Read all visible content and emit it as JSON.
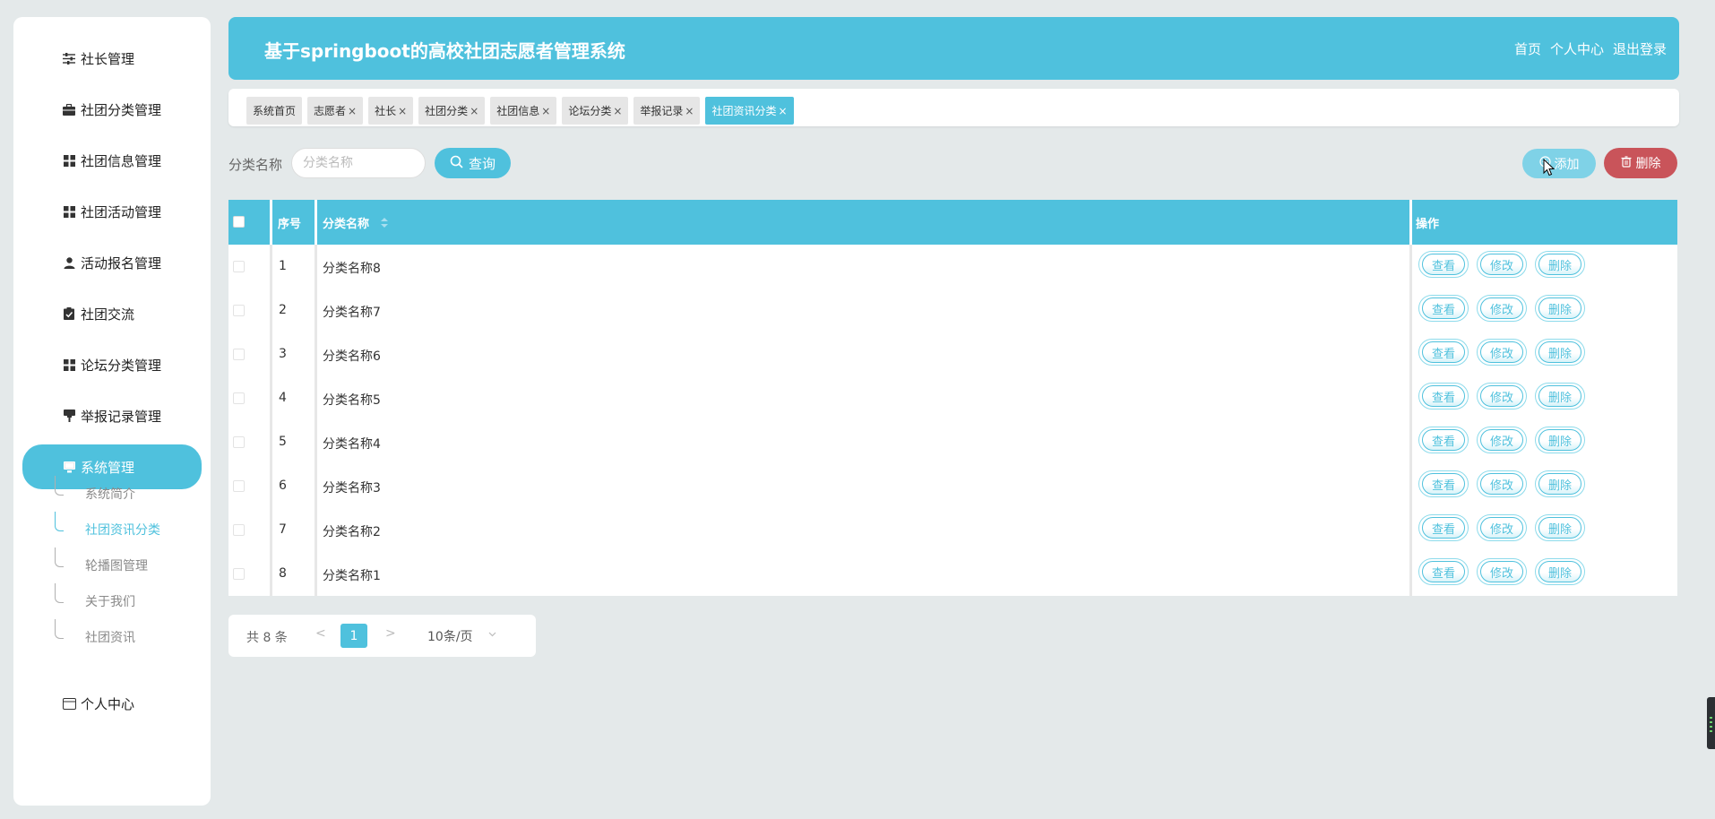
{
  "sidebar": {
    "menu": [
      {
        "label": "社长管理",
        "icon": "sliders-icon",
        "active": false
      },
      {
        "label": "社团分类管理",
        "icon": "briefcase-icon",
        "active": false
      },
      {
        "label": "社团信息管理",
        "icon": "grid-icon",
        "active": false
      },
      {
        "label": "社团活动管理",
        "icon": "grid-icon",
        "active": false
      },
      {
        "label": "活动报名管理",
        "icon": "user-icon",
        "active": false
      },
      {
        "label": "社团交流",
        "icon": "clipboard-check-icon",
        "active": false
      },
      {
        "label": "论坛分类管理",
        "icon": "grid-icon",
        "active": false
      },
      {
        "label": "举报记录管理",
        "icon": "flag-icon",
        "active": false
      },
      {
        "label": "系统管理",
        "icon": "monitor-icon",
        "active": true
      }
    ],
    "submenu": [
      {
        "label": "系统简介",
        "active": false
      },
      {
        "label": "社团资讯分类",
        "active": true
      },
      {
        "label": "轮播图管理",
        "active": false
      },
      {
        "label": "关于我们",
        "active": false
      },
      {
        "label": "社团资讯",
        "active": false
      }
    ],
    "profile": {
      "label": "个人中心",
      "icon": "card-icon"
    }
  },
  "header": {
    "title": "基于springboot的高校社团志愿者管理系统",
    "links": [
      "首页",
      "个人中心",
      "退出登录"
    ]
  },
  "tabs": [
    {
      "label": "系统首页",
      "closable": false,
      "active": false
    },
    {
      "label": "志愿者",
      "closable": true,
      "active": false
    },
    {
      "label": "社长",
      "closable": true,
      "active": false
    },
    {
      "label": "社团分类",
      "closable": true,
      "active": false
    },
    {
      "label": "社团信息",
      "closable": true,
      "active": false
    },
    {
      "label": "论坛分类",
      "closable": true,
      "active": false
    },
    {
      "label": "举报记录",
      "closable": true,
      "active": false
    },
    {
      "label": "社团资讯分类",
      "closable": true,
      "active": true
    }
  ],
  "toolbar": {
    "search_label": "分类名称",
    "search_placeholder": "分类名称",
    "query_label": "查询",
    "add_label": "添加",
    "delete_label": "删除"
  },
  "table": {
    "headers": {
      "index": "序号",
      "name": "分类名称",
      "ops": "操作"
    },
    "rows": [
      {
        "index": "1",
        "name": "分类名称8"
      },
      {
        "index": "2",
        "name": "分类名称7"
      },
      {
        "index": "3",
        "name": "分类名称6"
      },
      {
        "index": "4",
        "name": "分类名称5"
      },
      {
        "index": "5",
        "name": "分类名称4"
      },
      {
        "index": "6",
        "name": "分类名称3"
      },
      {
        "index": "7",
        "name": "分类名称2"
      },
      {
        "index": "8",
        "name": "分类名称1"
      }
    ],
    "row_actions": {
      "view": "查看",
      "edit": "修改",
      "delete": "删除"
    }
  },
  "pagination": {
    "total": "共 8 条",
    "prev": "<",
    "current_page": "1",
    "next": ">",
    "page_size": "10条/页"
  },
  "colors": {
    "accent": "#4fc1dd",
    "danger": "#c9545a",
    "background": "#e4e9ea"
  }
}
